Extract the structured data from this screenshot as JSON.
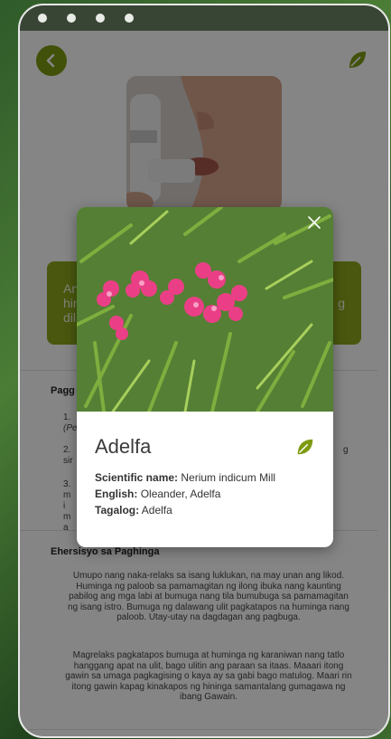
{
  "background_page": {
    "banner_lines": [
      "An",
      "hin",
      "dil"
    ],
    "banner_right_char": "g",
    "section_paggamit": {
      "title": "Pagg",
      "items": [
        {
          "num": "1.",
          "text": "(Pe"
        },
        {
          "num": "2.",
          "text": "sir",
          "right": "g"
        },
        {
          "num": "3.",
          "text": "mi ma"
        }
      ]
    },
    "section_ehersisyo": {
      "title": "Ehersisyo sa Paghinga",
      "paragraph1": "Umupo nang naka-relaks sa isang luklukan, na may unan ang likod. Huminga ng paloob sa pamamagitan ng ilong ibuka nang kaunting pabilog ang mga labi at bumuga nang tila bumubuga sa pamamagitan ng isang istro. Bumuga ng dalawang ulit pagkatapos na huminga nang paloob. Utay-utay na dagdagan ang pagbuga.",
      "paragraph2": "Magrelaks pagkatapos bumuga at huminga ng karaniwan nang tatlo hanggang apat na ulit, bago ulitin ang paraan sa itaas. Maaari itong gawin sa umaga pagkagising o kaya ay sa gabi bago matulog. Maari rin itong gawin kapag kinakapos ng hininga samantalang gumagawa ng ibang Gawain."
    }
  },
  "modal": {
    "name": "Adelfa",
    "scientific_label": "Scientific name:",
    "scientific_value": "Nerium indicum Mill",
    "english_label": "English:",
    "english_value": "Oleander, Adelfa",
    "tagalog_label": "Tagalog:",
    "tagalog_value": "Adelfa"
  },
  "colors": {
    "accent": "#7d9b12",
    "statusbar": "#384534"
  },
  "icons": {
    "back": "chevron-left-icon",
    "leaf": "leaf-icon",
    "close": "close-icon"
  }
}
